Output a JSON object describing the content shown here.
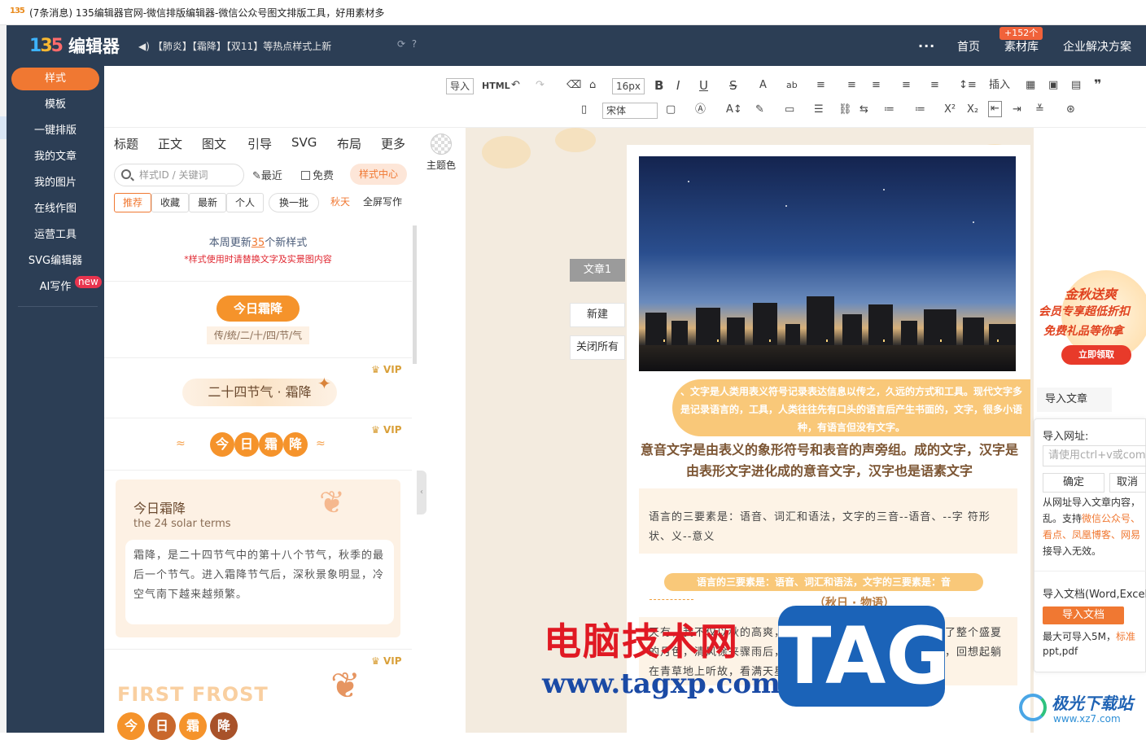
{
  "browser": {
    "title": "(7条消息) 135编辑器官网-微信排版编辑器-微信公众号图文排版工具，好用素材多",
    "favicon": "135"
  },
  "topnav": {
    "brand_mark": "135",
    "brand_name": "编辑器",
    "notice": "【肺炎】【霜降】【双11】等热点样式上新",
    "home": "首页",
    "materials": "素材库",
    "materials_badge": "+152个",
    "enterprise": "企业解决方案",
    "more": "..."
  },
  "sidebar": {
    "items": [
      {
        "label": "样式"
      },
      {
        "label": "模板"
      },
      {
        "label": "一键排版"
      },
      {
        "label": "我的文章"
      },
      {
        "label": "我的图片"
      },
      {
        "label": "在线作图"
      },
      {
        "label": "运营工具"
      },
      {
        "label": "SVG编辑器"
      },
      {
        "label": "AI写作"
      }
    ],
    "new_badge": "new"
  },
  "toolbar": {
    "import": "导入",
    "html": "HTML",
    "font_size": "16px",
    "font_family": "宋体",
    "insert": "插入",
    "bold": "B",
    "italic": "I",
    "underline": "U",
    "strike": "S",
    "sup": "X²",
    "sub": "X₂",
    "quote": "❞"
  },
  "stylepanel": {
    "categories": [
      "标题",
      "正文",
      "图文",
      "引导",
      "SVG",
      "布局",
      "更多"
    ],
    "search_placeholder": "样式ID / 关键词",
    "recent": "最近",
    "free": "免费",
    "style_center": "样式中心",
    "subtabs": [
      "推荐",
      "收藏",
      "最新",
      "个人",
      "换一批",
      "秋天",
      "全屏写作"
    ],
    "weekly_prefix": "本周更新",
    "weekly_count": "35",
    "weekly_suffix": "个新样式",
    "weekly_note": "*样式使用时请替换文字及实景图内容",
    "s1_title": "今日霜降",
    "s1_sub": "传/统/二/十/四/节/气",
    "vip": "VIP",
    "s2_title": "二十四节气 · 霜降",
    "s3_chars": [
      "今",
      "日",
      "霜",
      "降"
    ],
    "card_title": "今日霜降",
    "card_sub": "the 24 solar terms",
    "card_body": "霜降，是二十四节气中的第十八个节气，秋季的最后一个节气。进入霜降节气后，深秋景象明显，冷空气南下越来越频繁。",
    "ff_title": "FIRST FROST",
    "ff_chars": [
      "今",
      "日",
      "霜",
      "降"
    ]
  },
  "theme": {
    "label": "主题色"
  },
  "docs": {
    "tab": "文章1",
    "new": "新建",
    "close_all": "关闭所有"
  },
  "editor": {
    "ribbon": "、文字是人类用表义符号记录表达信息以传之，久远的方式和工具。现代文字多是记录语言的，工具，人类往往先有口头的语言后产生书面的，文字，很多小语种，有语言但没有文字。",
    "heading": "意音文字是由表义的象形符号和表音的声旁组。成的文字，汉字是由表形文字进化成的意音文字，汉字也是语素文字",
    "box1": "语言的三要素是：语音、词汇和语法，文字的三音--语音、--字 符形状、义--意义",
    "ribbon2": "语言的三要素是：语音、词汇和语法，文字的三要素是：音",
    "subtitle": "（秋日 · 物语）",
    "box2": "天有，我不仅以秋的高爽，折所的细而和温温的彩云，积换了整个盛夏的月色，清风徐来骤雨后，高数远方的太阳伴随着一丝凉意，回想起躺在青草地上听故，看满天星辰。"
  },
  "rightpanel": {
    "promo_l1": "金秋送爽",
    "promo_l2": "会员专享超低折扣",
    "promo_l3": "免费礼品等你拿",
    "promo_btn": "立即领取",
    "import_tab": "导入文章",
    "url_label": "导入网址:",
    "url_placeholder": "请使用ctrl+v或command+v粘贴",
    "ok": "确定",
    "cancel": "取消",
    "desc1": "从网址导入文章内容，",
    "desc2": "乱。支持",
    "desc2o": "微信公众号、",
    "desc3o": "看点、凤凰博客、网易",
    "desc4": "接导入无效。",
    "doc_label": "导入文档(Word,Excel)",
    "doc_btn": "导入文档",
    "size_note": "最大可导入5M，",
    "size_note_o": "标准",
    "formats": "ppt,pdf"
  },
  "watermark": {
    "cn": "电脑技术网",
    "url": "www.tagxp.com",
    "tag": "TAG",
    "jg_a": "极光下载站",
    "jg_b": "www.xz7.com"
  },
  "colors": {
    "accent": "#f07832",
    "nav": "#2c3e55",
    "ribbon": "#f9c879"
  }
}
